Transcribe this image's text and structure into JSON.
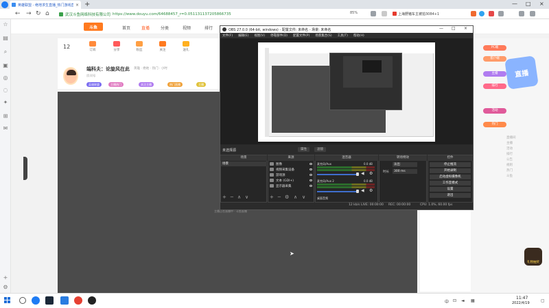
{
  "browser": {
    "tab_title": "英雄联盟 - 绝地求生直播_热门游戏直播_斗鱼",
    "close_glyph": "×",
    "new_tab_glyph": "+",
    "url_security": "武汉斗鱼网络科技有限公司",
    "url": "https://www.douyu.com/64688457_r=0.051131137205866735",
    "zoom": "85%",
    "search_text": "上海野猪车主被拍3084+1",
    "window_controls": [
      "—",
      "□",
      "×"
    ]
  },
  "site": {
    "logo_text": "斗鱼",
    "nav": [
      "首页",
      "直播",
      "分类",
      "视频",
      "排行"
    ],
    "streamer_icons": [
      "订阅",
      "分享",
      "粉丝",
      "关注",
      "送礼"
    ],
    "fans_count": "12",
    "room_title": "端科夫：论旋风在此",
    "room_meta": "英雄 · 绝地 · 热门 · 小时",
    "room_id": "房间号",
    "tags": [
      "英雄联盟",
      "主播热门",
      "关注主播",
      "热门直播",
      "主播"
    ],
    "promo_pills": [
      "PC端",
      "客户端",
      "主播",
      "排行",
      "活动",
      "热门"
    ],
    "promo_badge": "直播",
    "side_texts": [
      "直播间",
      "主播",
      "活动",
      "排行",
      "公告",
      "规则",
      "热门",
      "斗鱼"
    ],
    "gift_label": "礼物抽奖",
    "footer": "主播正在直播中 · 斗鱼直播"
  },
  "obs": {
    "title": "OBS 27.0.0 (64-bit, windows) - 配置文件: 未命名 - 场景: 未命名",
    "window_controls": [
      "—",
      "□",
      "×"
    ],
    "menu": [
      "文件(F)",
      "编辑(E)",
      "视图(V)",
      "停靠部件(D)",
      "配置文件(P)",
      "场景集合(S)",
      "工具(T)",
      "帮助(H)"
    ],
    "scene_bar_label": "未选择源",
    "scene_bar_buttons": [
      "属性",
      "滤镜"
    ],
    "docks": {
      "scenes_title": "场景",
      "sources_title": "来源",
      "mixer_title": "混音器",
      "transitions_title": "转场特效",
      "controls_title": "控件"
    },
    "scenes": [
      "场景"
    ],
    "sources": [
      "图像",
      "视频采集设备",
      "游戏源",
      "文本 (GDI+)",
      "显示器采集"
    ],
    "mixer": [
      {
        "name": "麦克风/Aux",
        "db": "0.0 dB"
      },
      {
        "name": "麦克风/Aux 2",
        "db": "0.0 dB"
      },
      {
        "name": "桌面音频",
        "db": "0.0 dB"
      }
    ],
    "transitions": {
      "select_label": "淡出",
      "duration_label": "时长",
      "duration_value": "300 ms"
    },
    "controls": [
      "停止推流",
      "开始录制",
      "启动虚拟摄像机",
      "工作室模式",
      "设置",
      "退出"
    ],
    "dock_footer_glyphs": [
      "+",
      "−",
      "∧",
      "∨"
    ],
    "status": {
      "dropped": "0 (0.0%)",
      "live": "LIVE: 00:00:00",
      "rec": "REC: 00:00:00",
      "cpu": "CPU: 1.0%, 60.00 fps",
      "kbps": "12 kb/s"
    }
  },
  "taskbar": {
    "tray_text": "中",
    "time": "11:47",
    "date": "2022/4/19"
  },
  "colors": {
    "accent_orange": "#ff7a1f",
    "obs_dark": "#2b2b2b",
    "url_green": "#2a8b3e"
  }
}
